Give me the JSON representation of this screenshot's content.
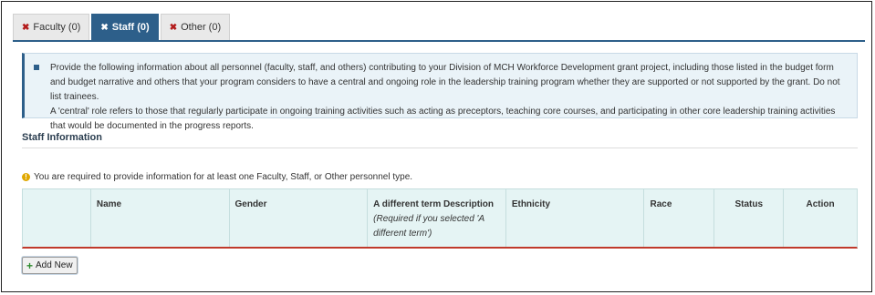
{
  "tabs": [
    {
      "icon": "close-icon",
      "label": "Faculty (0)",
      "active": false
    },
    {
      "icon": "close-icon",
      "label": "Staff (0)",
      "active": true
    },
    {
      "icon": "close-icon",
      "label": "Other (0)",
      "active": false
    }
  ],
  "notice": {
    "line1": "Provide the following information about all personnel (faculty, staff, and others) contributing to your Division of MCH Workforce Development grant project, including those listed in the budget form and budget narrative and others that your program considers to have a central and ongoing role in the leadership training program whether they are supported or not supported by the grant. Do not list trainees.",
    "line2": "A 'central' role refers to those that regularly participate in ongoing training activities such as acting as preceptors, teaching core courses, and participating in other core leadership training activities that would be documented in the progress reports."
  },
  "section": {
    "title": "Staff Information"
  },
  "warning": {
    "text": "You are required to provide information for at least one Faculty, Staff, or Other personnel type."
  },
  "table": {
    "headers": [
      "",
      "Name",
      "Gender",
      "A different term Description",
      "Ethnicity",
      "Race",
      "Status",
      "Action"
    ],
    "term_note": "(Required if you selected 'A different term')"
  },
  "add_button": {
    "label": "Add New",
    "icon": "plus-icon"
  }
}
